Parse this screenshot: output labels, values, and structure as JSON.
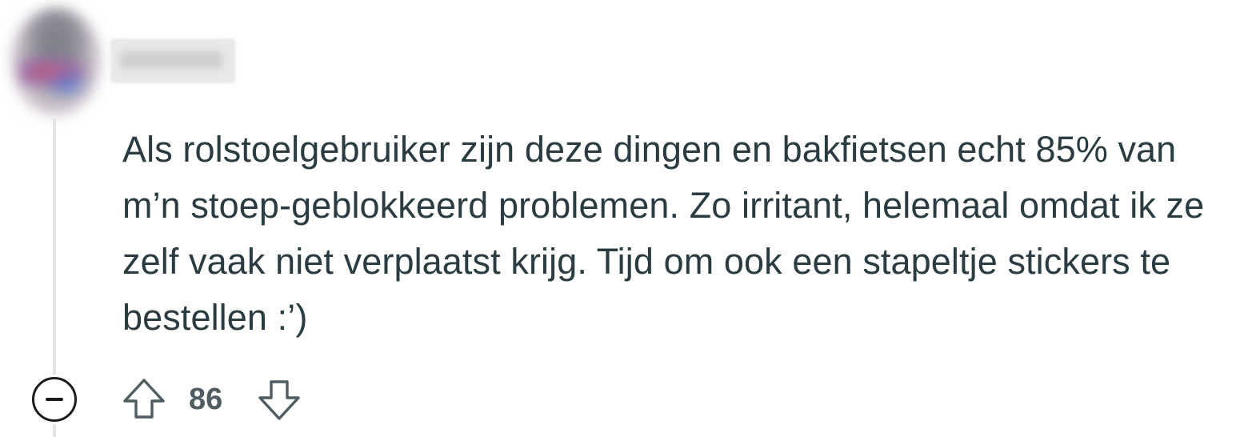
{
  "comment": {
    "author": "username",
    "body": "Als rolstoelgebruiker zijn deze dingen en bakfietsen echt 85% van m’n stoep-geblokkeerd problemen. Zo irritant, helemaal omdat ik ze zelf vaak niet verplaatst krijg. Tijd om ook een stapeltje stickers te bestellen :’)",
    "score": "86"
  },
  "icons": {
    "collapse": "minus-circle-icon",
    "upvote": "arrow-up-outline-icon",
    "downvote": "arrow-down-outline-icon"
  }
}
